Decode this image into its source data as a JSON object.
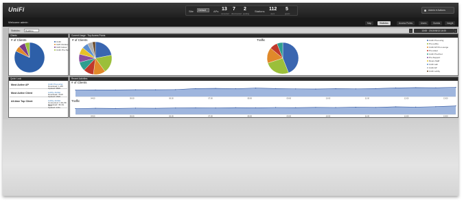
{
  "header": {
    "logo": "UniFi",
    "site_label": "Site",
    "site_value": "Default",
    "aps_label": "APs",
    "aps_count": "13",
    "aps_sub": "connected",
    "aps_count2": "7",
    "aps_sub2": "disconnected",
    "aps_count3": "2",
    "aps_sub3": "pending",
    "stations_label": "Stations",
    "stations_count": "112",
    "stations_sub": "users",
    "stations_count2": "5",
    "stations_sub2": "guests",
    "user_menu": "Admin ▾ Actions"
  },
  "nav": {
    "welcome": "Welcome admin",
    "tabs": [
      "Map",
      "Statistics",
      "Access Points",
      "Users",
      "Guests",
      "Insight"
    ],
    "active_tab": "Statistics"
  },
  "filter": {
    "label": "Statistics:",
    "select_value": "Realtime",
    "date_range": "13:00 · 2013/05/13 14:00",
    "prev": "‹",
    "next": "›",
    "update_button": "Update Graph"
  },
  "panels": {
    "clients_header": "Clients",
    "clients_title": "# of Clients",
    "clients_legend": [
      "UniFi",
      "UAP-Outdoor",
      "UAP-Indoor",
      "UniFi Pro-Top"
    ],
    "current_usage_header": "Current Usage - Top Access Points",
    "current_clients_title": "# of Clients",
    "traffic_title": "Traffic",
    "traffic_legend": [
      "UniFi Pro-Living",
      "Pro-Lobby",
      "UniFi AP Pro-Lounge",
      "Pro-Hotel",
      "UniFi Pro-Pool",
      "Pro-Support",
      "Room-Staff",
      "UniFi Lab",
      "UniFi AP",
      "UniFi Lobby"
    ],
    "quick_look_header": "Quick Look",
    "recent_activities_header": "Recent Activities",
    "activity_clients_title": "# of Clients",
    "activity_traffic_title": "Traffic"
  },
  "quick_look": [
    {
      "label": "Most Active AP",
      "name": "UniFi Pro-Living",
      "line2": "Download: 1.4M",
      "line3": "Upload: 381K"
    },
    {
      "label": "Most Active Client",
      "name": "Lobby-Jordan",
      "line2": "Download: 761K",
      "line3": "Upload: 161K"
    },
    {
      "label": "All-time Top Client",
      "name": "Lobby-Jordan",
      "line2": "Connected: 1 Mo 8h 47m",
      "line3": "Download: 49.4G · Upload: 4.4G"
    }
  ],
  "chart_data": [
    {
      "type": "pie",
      "title": "# of Clients",
      "categories": [
        "UniFi",
        "UAP-Outdoor",
        "UAP-Indoor",
        "UniFi Pro-Top"
      ],
      "values": [
        82,
        6,
        7,
        5
      ],
      "colors": [
        "#2d5fa8",
        "#e08a2a",
        "#7a3a8a",
        "#9bbf3a"
      ]
    },
    {
      "type": "pie",
      "title": "# of Clients",
      "categories": [
        "UniFi Pro-Living",
        "Pro-Lobby",
        "UniFi AP Pro-Lounge",
        "Pro-Hotel",
        "UniFi Pro-Pool",
        "Pro-Support",
        "Room-Staff",
        "UniFi Lab",
        "UniFi AP",
        "UniFi Lobby"
      ],
      "values": [
        22,
        18,
        12,
        10,
        9,
        8,
        7,
        6,
        5,
        3
      ],
      "colors": [
        "#3a66b0",
        "#9bbf3a",
        "#e0892a",
        "#c0392b",
        "#2f9e8f",
        "#8a4ea0",
        "#e6c229",
        "#5d8fcf",
        "#b0b0b0",
        "#6b4a2a"
      ]
    },
    {
      "type": "pie",
      "title": "Traffic",
      "categories": [
        "UniFi Pro-Living",
        "Pro-Lobby",
        "UniFi AP Pro-Lounge",
        "Pro-Hotel",
        "UniFi Pro-Pool"
      ],
      "values": [
        44,
        26,
        16,
        8,
        6
      ],
      "colors": [
        "#3a66b0",
        "#9bbf3a",
        "#e0892a",
        "#c0392b",
        "#2f9e8f"
      ]
    },
    {
      "type": "area",
      "title": "# of Clients",
      "x": [
        "04:00",
        "05:00",
        "06:00",
        "07:00",
        "08:00",
        "09:00",
        "10:00",
        "11:00",
        "12:00",
        "13:00"
      ],
      "values": [
        42,
        43,
        43,
        44,
        44,
        45,
        52,
        53,
        51,
        55,
        52,
        50,
        49,
        51,
        50,
        52,
        56,
        58,
        57,
        60
      ],
      "ylim": [
        0,
        80
      ],
      "color": "#9fb6de"
    },
    {
      "type": "area",
      "title": "Traffic",
      "x": [
        "04:00",
        "05:00",
        "06:00",
        "07:00",
        "08:00",
        "09:00",
        "10:00",
        "11:00",
        "12:00",
        "13:00"
      ],
      "values": [
        40,
        42,
        41,
        43,
        42,
        44,
        45,
        44,
        46,
        45,
        47,
        46,
        48,
        47,
        49,
        48,
        52,
        50,
        53,
        58
      ],
      "ylim": [
        0,
        80
      ],
      "color": "#9fb6de"
    }
  ]
}
